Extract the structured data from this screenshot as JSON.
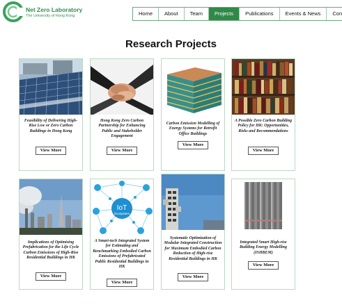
{
  "logo": {
    "title": "Net Zero Laboratory",
    "subtitle": "The University of Hong Kong"
  },
  "nav": {
    "items": [
      "Home",
      "About",
      "Team",
      "Projects",
      "Publications",
      "Events & News",
      "Contact"
    ],
    "active": "Projects"
  },
  "page": {
    "title": "Research Projects"
  },
  "projects": [
    {
      "title": "Feasibility of Delivering High-Rise Low or Zero Carbon Buildings in Hong Kong",
      "button": "View More"
    },
    {
      "title": "Hong Kong Zero Carbon Partnership for Enhancing Public and Stakeholder Engagement",
      "button": "View More"
    },
    {
      "title": "Carbon Emission Modelling of Energy Systems for Retrofit Office Buildings",
      "button": "View More"
    },
    {
      "title": "A Possible Zero Carbon Building Policy for HK: Opportunities, Risks and Recommendations",
      "button": "View More"
    },
    {
      "title": "Implications of Optimising Prefabrication for the Life Cycle Carbon Emissions of High-Rise Residential Buildings in HK",
      "button": "View More"
    },
    {
      "title": "A Smart-tech Integrated System for Estimating and Benchmarking Embodied Carbon Emissions of Prefabricated Public Residential Buildings in HK",
      "button": "View More"
    },
    {
      "title": "Systematic Optimization of Modular Integrated Construction for Maximum Embodied Carbon Reduction of High-rise Residential Buildings in HK",
      "button": "View More"
    },
    {
      "title": "Integrated Smart High-rise Building Energy Modelling (ISHBEM)",
      "button": "View More"
    }
  ],
  "images": {
    "iot_label_1": "IoT",
    "iot_label_2": "Ecosystem"
  },
  "colors": {
    "brand_green": "#2f8a48",
    "card_border": "#bcd7c4"
  }
}
